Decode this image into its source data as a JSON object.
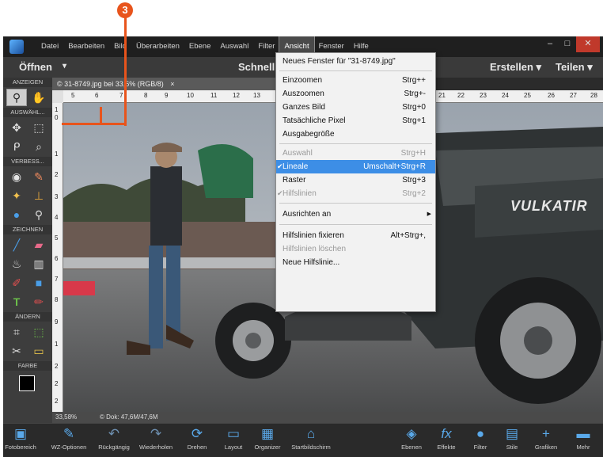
{
  "callout": {
    "number": "3"
  },
  "menubar": {
    "items": [
      "Datei",
      "Bearbeiten",
      "Bild",
      "Überarbeiten",
      "Ebene",
      "Auswahl",
      "Filter",
      "Ansicht",
      "Fenster",
      "Hilfe"
    ],
    "active": "Ansicht"
  },
  "toolbar": {
    "open_label": "Öffnen",
    "mode_label": "Schnell",
    "create_label": "Erstellen ▾",
    "share_label": "Teilen ▾"
  },
  "document": {
    "tab_title": "31-8749.jpg bei 33,6% (RGB/8)",
    "ruler_top": [
      "5",
      "6",
      "7",
      "8",
      "9",
      "10",
      "11",
      "12",
      "13",
      "21",
      "22",
      "23",
      "24",
      "25",
      "26",
      "27",
      "28"
    ],
    "ruler_left": [
      "1",
      "0",
      "1",
      "2",
      "3",
      "4",
      "5",
      "6",
      "7",
      "8",
      "9",
      "1",
      "2",
      "2",
      "2"
    ],
    "photo_text": "VULKATIR"
  },
  "tools": {
    "sections": [
      "ANZEIGEN",
      "AUSWÄHL...",
      "VERBESS...",
      "ZEICHNEN",
      "ÄNDERN",
      "FARBE"
    ]
  },
  "statusbar": {
    "zoom": "33,58%",
    "doc_size": "Dok: 47,6M/47,6M"
  },
  "menu": {
    "items": [
      {
        "label": "Neues Fenster für \"31-8749.jpg\"",
        "shortcut": ""
      },
      {
        "label": "Einzoomen",
        "shortcut": "Strg++"
      },
      {
        "label": "Auszoomen",
        "shortcut": "Strg+-"
      },
      {
        "label": "Ganzes Bild",
        "shortcut": "Strg+0"
      },
      {
        "label": "Tatsächliche Pixel",
        "shortcut": "Strg+1"
      },
      {
        "label": "Ausgabegröße",
        "shortcut": ""
      },
      {
        "label": "Auswahl",
        "shortcut": "Strg+H"
      },
      {
        "label": "Lineale",
        "shortcut": "Umschalt+Strg+R"
      },
      {
        "label": "Raster",
        "shortcut": "Strg+3"
      },
      {
        "label": "Hilfslinien",
        "shortcut": "Strg+2"
      },
      {
        "label": "Ausrichten an",
        "shortcut": ""
      },
      {
        "label": "Hilfslinien fixieren",
        "shortcut": "Alt+Strg+,"
      },
      {
        "label": "Hilfslinien löschen",
        "shortcut": ""
      },
      {
        "label": "Neue Hilfslinie...",
        "shortcut": ""
      }
    ]
  },
  "dock": {
    "items": [
      "Fotobereich",
      "WZ-Optionen",
      "Rückgängig",
      "Wiederholen",
      "Drehen",
      "Layout",
      "Organizer",
      "Startbildschirm",
      "Ebenen",
      "Effekte",
      "Filter",
      "Stile",
      "Grafiken",
      "Mehr"
    ]
  }
}
